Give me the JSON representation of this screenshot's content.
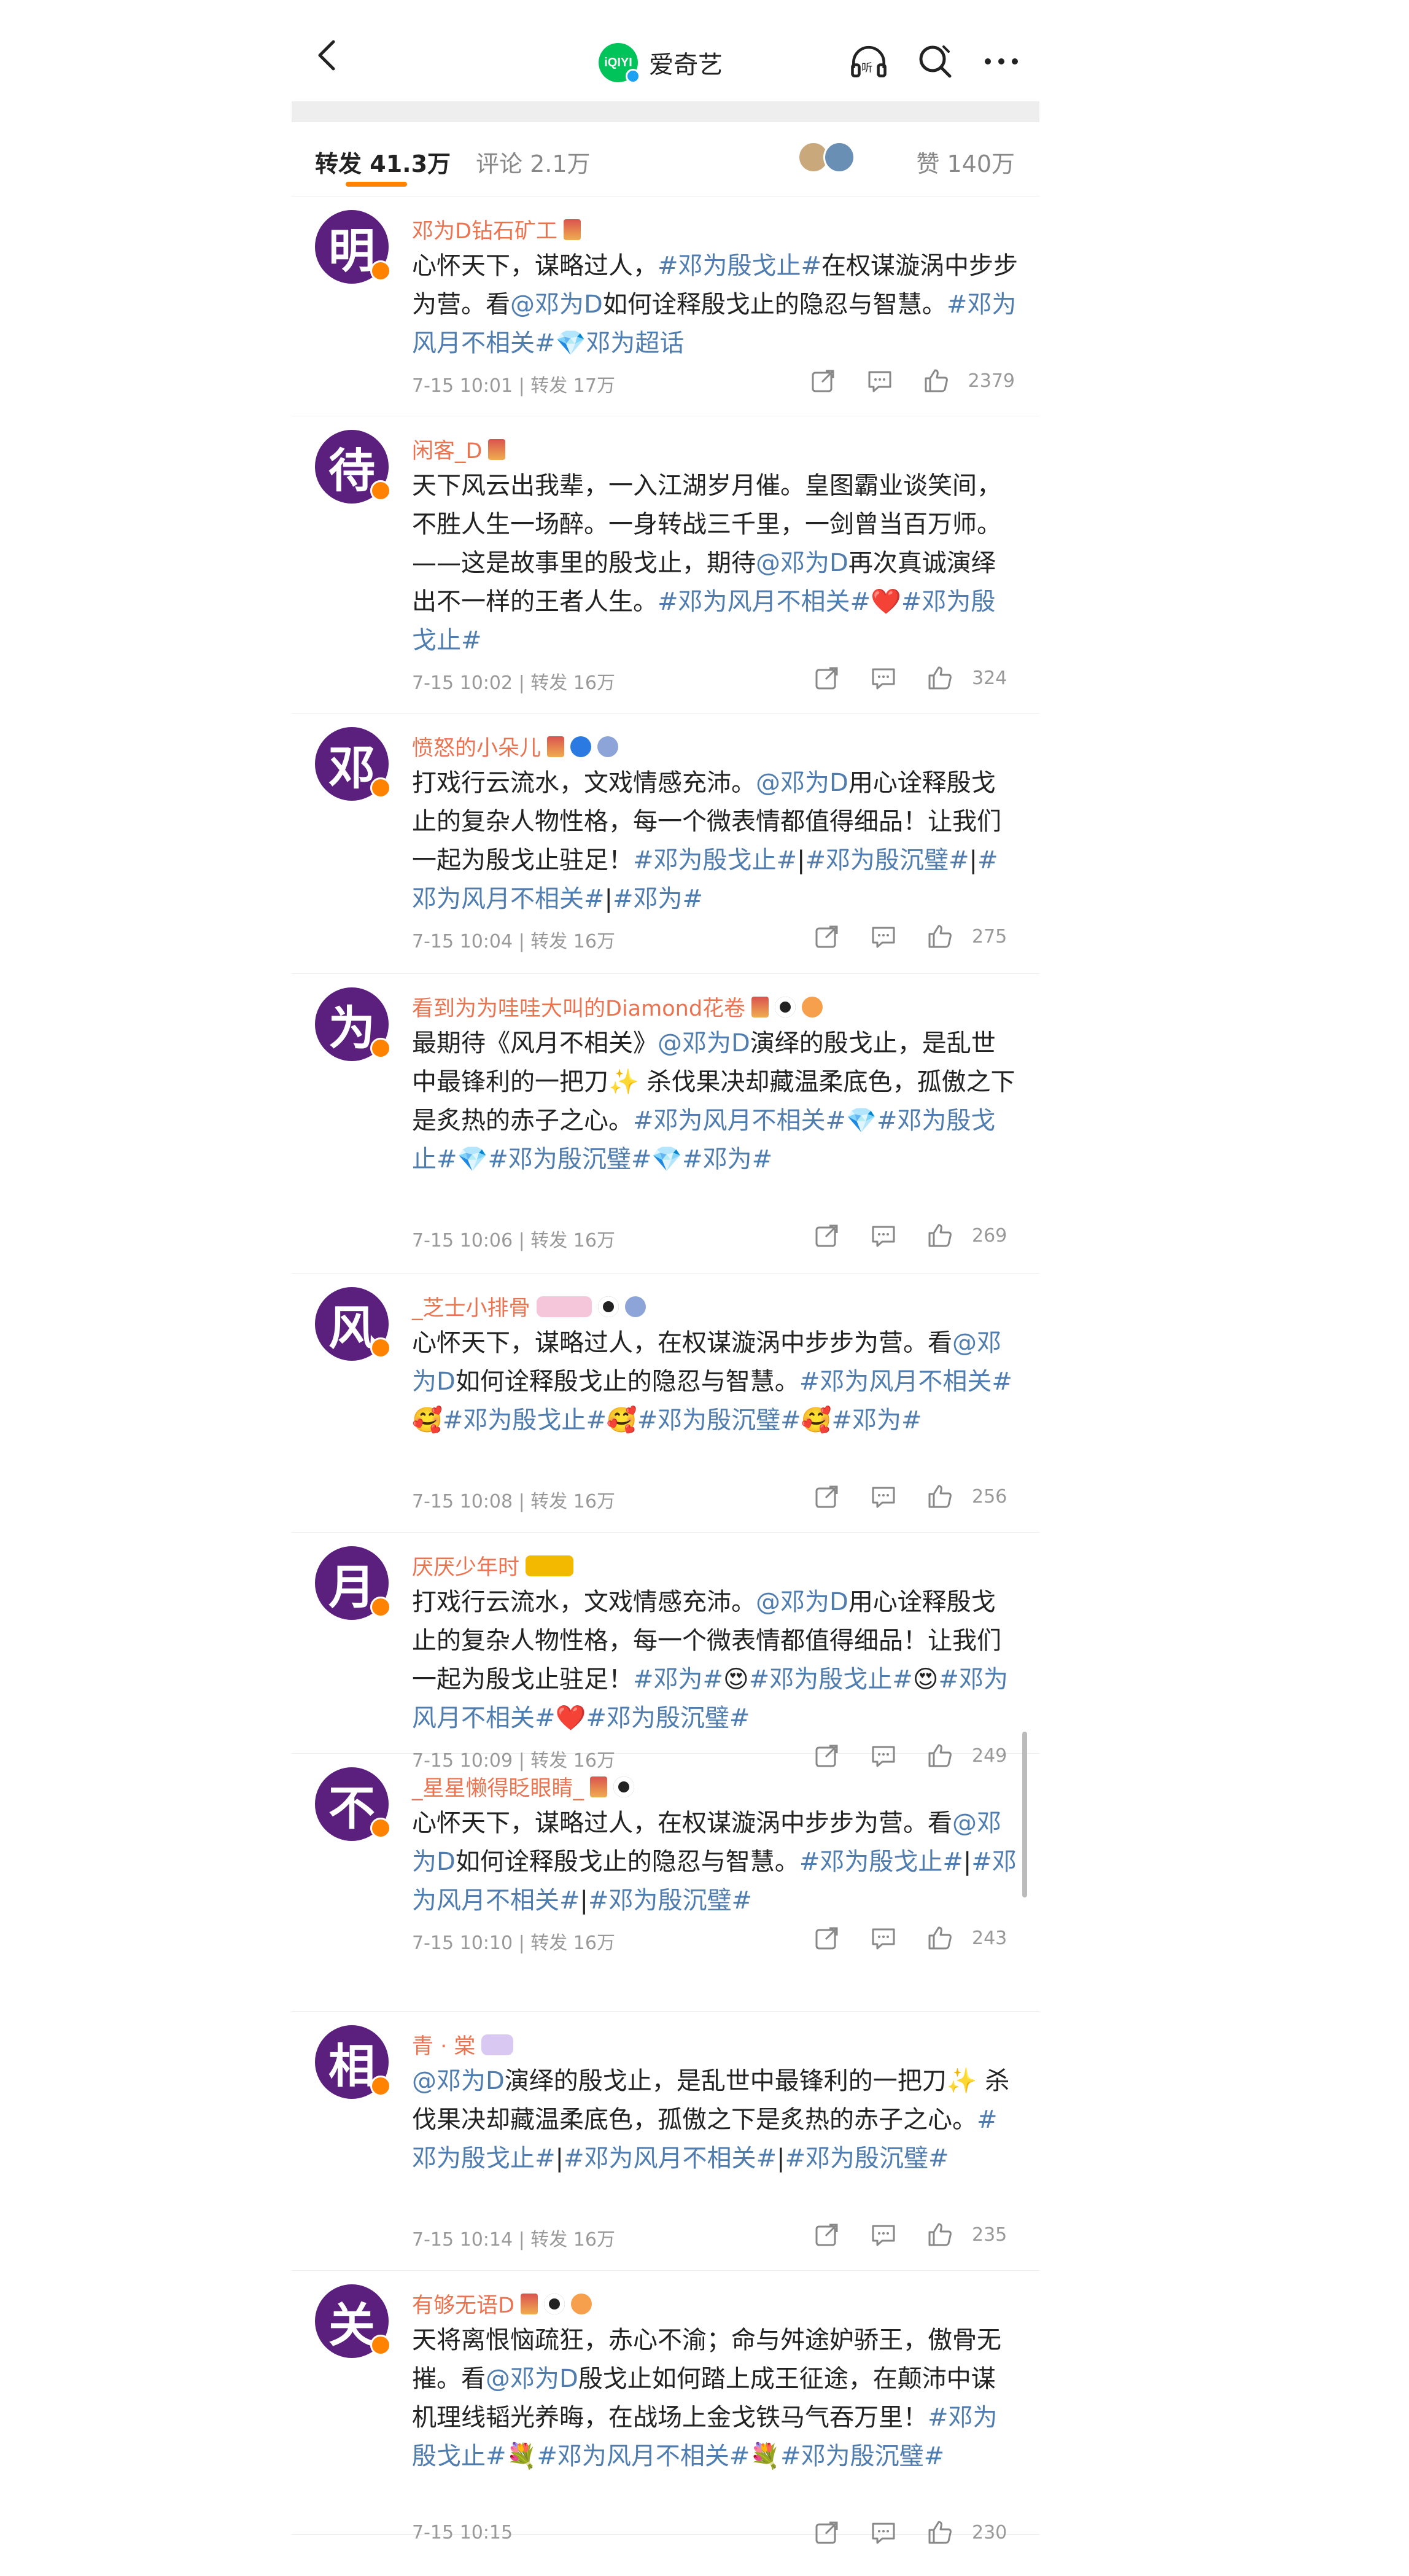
{
  "header": {
    "title": "爱奇艺",
    "logo_text": "iQIYI"
  },
  "tabs": {
    "forward": {
      "label": "转发",
      "count": "41.3万"
    },
    "comment": {
      "label": "评论",
      "count": "2.1万"
    },
    "like": {
      "label": "赞",
      "count": "140万"
    }
  },
  "colors": {
    "accent": "#ff8200",
    "link": "#507daf",
    "username": "#eb7350",
    "avatar_bg": "#5b1f7e"
  },
  "items": [
    {
      "avatar_char": "明",
      "name": "邓为D钻石矿工",
      "text": [
        [
          "",
          "心怀天下，谋略过人，"
        ],
        [
          "hl",
          "#邓为殷戈止#"
        ],
        [
          "",
          "在权谋漩涡中步步为营。看"
        ],
        [
          "hl",
          "@邓为D"
        ],
        [
          "",
          "如何诠释殷戈止的隐忍与智慧。"
        ],
        [
          "hl",
          "#邓为风月不相关#"
        ],
        [
          "hl",
          "💎邓为超话"
        ]
      ],
      "time": "7-15 10:01",
      "forward": "转发 17万",
      "likes": "2379"
    },
    {
      "avatar_char": "待",
      "name": "闲客_D",
      "text": [
        [
          "",
          "天下风云出我辈，一入江湖岁月催。皇图霸业谈笑间，不胜人生一场醉。一身转战三千里，一剑曾当百万师。——这是故事里的殷戈止，期待"
        ],
        [
          "hl",
          "@邓为D"
        ],
        [
          "",
          "再次真诚演绎出不一样的王者人生。"
        ],
        [
          "hl",
          "#邓为风月不相关#"
        ],
        [
          "",
          "❤️"
        ],
        [
          "hl",
          "#邓为殷戈止#"
        ]
      ],
      "time": "7-15 10:02",
      "forward": "转发 16万",
      "likes": "324"
    },
    {
      "avatar_char": "邓",
      "name": "愤怒的小朵儿",
      "text": [
        [
          "",
          "打戏行云流水，文戏情感充沛。"
        ],
        [
          "hl",
          "@邓为D"
        ],
        [
          "",
          "用心诠释殷戈止的复杂人物性格，每一个微表情都值得细品！让我们一起为殷戈止驻足！"
        ],
        [
          "hl",
          "#邓为殷戈止#"
        ],
        [
          "",
          "|"
        ],
        [
          "hl",
          "#邓为殷沉璧#"
        ],
        [
          "",
          "|"
        ],
        [
          "hl",
          "#邓为风月不相关#"
        ],
        [
          "",
          "|"
        ],
        [
          "hl",
          "#邓为#"
        ]
      ],
      "time": "7-15 10:04",
      "forward": "转发 16万",
      "likes": "275"
    },
    {
      "avatar_char": "为",
      "name": "看到为为哇哇大叫的Diamond花卷",
      "text": [
        [
          "",
          "最期待《风月不相关》"
        ],
        [
          "hl",
          "@邓为D"
        ],
        [
          "",
          "演绎的殷戈止，是乱世中最锋利的一把刀✨ 杀伐果决却藏温柔底色，孤傲之下是炙热的赤子之心。"
        ],
        [
          "hl",
          "#邓为风月不相关#"
        ],
        [
          "",
          "💎"
        ],
        [
          "hl",
          "#邓为殷戈止#"
        ],
        [
          "",
          "💎"
        ],
        [
          "hl",
          "#邓为殷沉璧#"
        ],
        [
          "",
          "💎"
        ],
        [
          "hl",
          "#邓为#"
        ]
      ],
      "time": "7-15 10:06",
      "forward": "转发 16万",
      "likes": "269"
    },
    {
      "avatar_char": "风",
      "name": "_芝士小排骨",
      "text": [
        [
          "",
          "心怀天下，谋略过人，在权谋漩涡中步步为营。看"
        ],
        [
          "hl",
          "@邓为D"
        ],
        [
          "",
          "如何诠释殷戈止的隐忍与智慧。"
        ],
        [
          "hl",
          "#邓为风月不相关#"
        ],
        [
          "",
          "🥰"
        ],
        [
          "hl",
          "#邓为殷戈止#"
        ],
        [
          "",
          "🥰"
        ],
        [
          "hl",
          "#邓为殷沉璧#"
        ],
        [
          "",
          "🥰"
        ],
        [
          "hl",
          "#邓为#"
        ]
      ],
      "time": "7-15 10:08",
      "forward": "转发 16万",
      "likes": "256"
    },
    {
      "avatar_char": "月",
      "name": "厌厌少年时",
      "text": [
        [
          "",
          "打戏行云流水，文戏情感充沛。"
        ],
        [
          "hl",
          "@邓为D"
        ],
        [
          "",
          "用心诠释殷戈止的复杂人物性格，每一个微表情都值得细品！让我们一起为殷戈止驻足！"
        ],
        [
          "hl",
          "#邓为#"
        ],
        [
          "",
          "😍"
        ],
        [
          "hl",
          "#邓为殷戈止#"
        ],
        [
          "",
          "😍"
        ],
        [
          "hl",
          "#邓为风月不相关#"
        ],
        [
          "",
          "❤️"
        ],
        [
          "hl",
          "#邓为殷沉璧#"
        ]
      ],
      "time": "7-15 10:09",
      "forward": "转发 16万",
      "likes": "249"
    },
    {
      "avatar_char": "不",
      "name": "_星星懒得眨眼睛_",
      "text": [
        [
          "",
          "心怀天下，谋略过人，在权谋漩涡中步步为营。看"
        ],
        [
          "hl",
          "@邓为D"
        ],
        [
          "",
          "如何诠释殷戈止的隐忍与智慧。"
        ],
        [
          "hl",
          "#邓为殷戈止#"
        ],
        [
          "",
          "|"
        ],
        [
          "hl",
          "#邓为风月不相关#"
        ],
        [
          "",
          "|"
        ],
        [
          "hl",
          "#邓为殷沉璧#"
        ]
      ],
      "time": "7-15 10:10",
      "forward": "转发 16万",
      "likes": "243"
    },
    {
      "avatar_char": "相",
      "name": "青 · 棠",
      "text": [
        [
          "hl",
          "@邓为D"
        ],
        [
          "",
          "演绎的殷戈止，是乱世中最锋利的一把刀✨ 杀伐果决却藏温柔底色，孤傲之下是炙热的赤子之心。"
        ],
        [
          "hl",
          "#邓为殷戈止#"
        ],
        [
          "",
          "|"
        ],
        [
          "hl",
          "#邓为风月不相关#"
        ],
        [
          "",
          "|"
        ],
        [
          "hl",
          "#邓为殷沉璧#"
        ]
      ],
      "time": "7-15 10:14",
      "forward": "转发 16万",
      "likes": "235"
    },
    {
      "avatar_char": "关",
      "name": "有够无语D",
      "text": [
        [
          "",
          "天将离恨恼疏狂，赤心不渝；命与舛途妒骄王，傲骨无摧。看"
        ],
        [
          "hl",
          "@邓为D"
        ],
        [
          "",
          "殷戈止如何踏上成王征途，在颠沛中谋机理线韬光养晦，在战场上金戈铁马气吞万里！"
        ],
        [
          "hl",
          "#邓为殷戈止#"
        ],
        [
          "",
          "💐"
        ],
        [
          "hl",
          "#邓为风月不相关#"
        ],
        [
          "",
          "💐"
        ],
        [
          "hl",
          "#邓为殷沉璧#"
        ]
      ],
      "time": "7-15 10:15",
      "forward": "",
      "likes": "230"
    }
  ]
}
